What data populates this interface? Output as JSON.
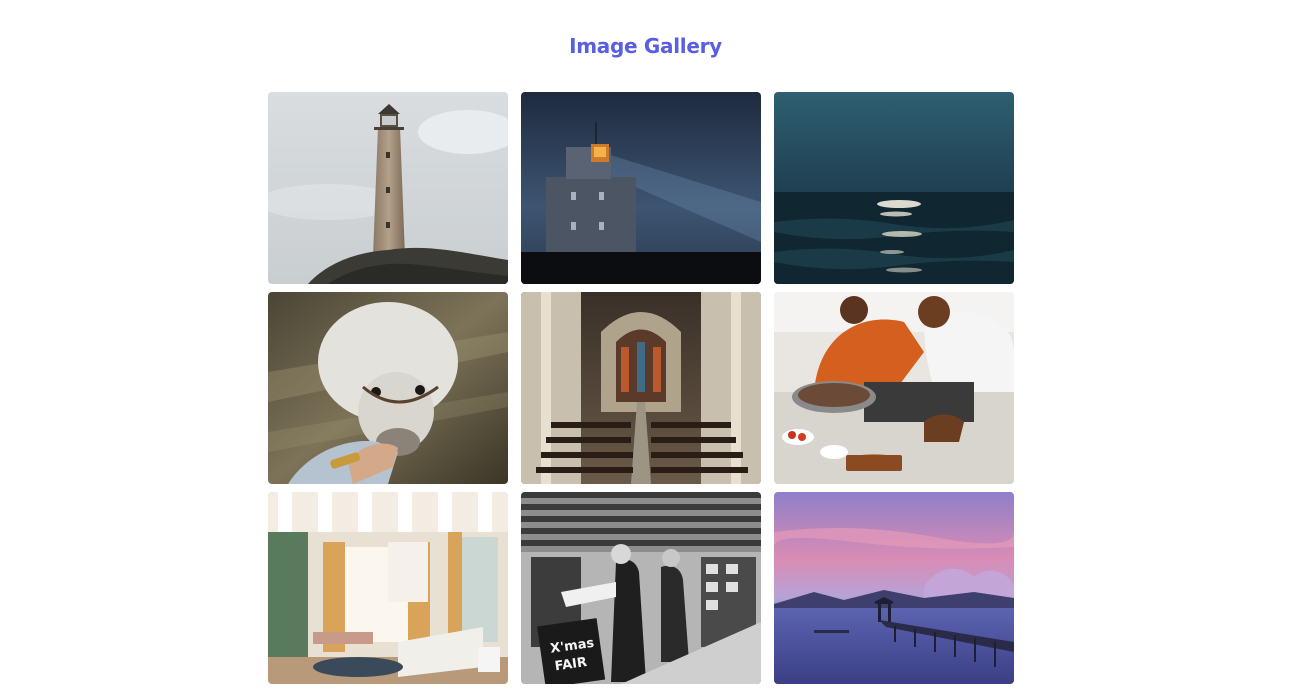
{
  "gallery": {
    "title": "Image Gallery",
    "accent_color": "#5a5ee0",
    "images": [
      {
        "subject": "lighthouse-on-cliff"
      },
      {
        "subject": "lighthouse-at-night"
      },
      {
        "subject": "moonlit-sea"
      },
      {
        "subject": "alpaca-being-fed"
      },
      {
        "subject": "cathedral-interior"
      },
      {
        "subject": "cooking-in-kitchen"
      },
      {
        "subject": "living-room-interior"
      },
      {
        "subject": "christmas-fair-market",
        "sign_text": [
          "X'mas",
          "FAIR"
        ]
      },
      {
        "subject": "pier-at-sunset"
      }
    ]
  }
}
